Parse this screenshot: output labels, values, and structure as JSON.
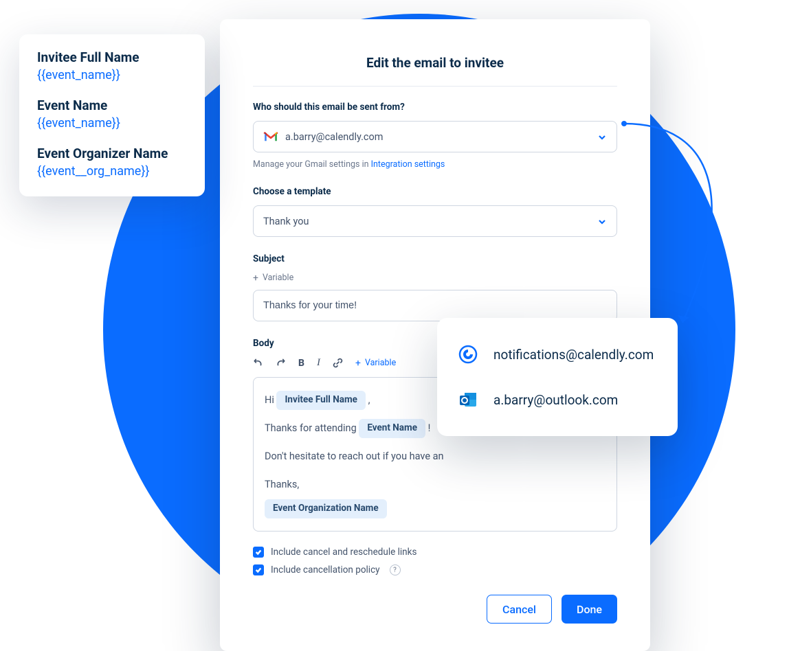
{
  "variables_card": {
    "items": [
      {
        "label": "Invitee Full Name",
        "token": "{{event_name}}"
      },
      {
        "label": "Event Name",
        "token": "{{event_name}}"
      },
      {
        "label": "Event Organizer Name",
        "token": "{{event__org_name}}"
      }
    ]
  },
  "modal": {
    "title": "Edit the email to invitee",
    "sender": {
      "label": "Who should this email be sent from?",
      "selected": "a.barry@calendly.com",
      "helper_prefix": "Manage your Gmail settings in ",
      "helper_link": "Integration settings"
    },
    "template": {
      "label": "Choose a template",
      "selected": "Thank you"
    },
    "subject": {
      "label": "Subject",
      "add_variable": "Variable",
      "value": "Thanks for your time!"
    },
    "body": {
      "label": "Body",
      "add_variable": "Variable",
      "greeting_prefix": "Hi  ",
      "greeting_chip": "Invitee Full Name",
      "greeting_suffix": "  ,",
      "line2_prefix": "Thanks for attending  ",
      "line2_chip": "Event Name",
      "line2_suffix": "  !",
      "line3": "Don't hesitate to reach out if you have an",
      "signoff": "Thanks,",
      "signoff_chip": "Event Organization Name"
    },
    "options": {
      "include_links": "Include cancel and reschedule links",
      "include_policy": "Include cancellation policy"
    },
    "footer": {
      "cancel": "Cancel",
      "done": "Done"
    }
  },
  "sender_options": [
    {
      "icon": "calendly",
      "email": "notifications@calendly.com"
    },
    {
      "icon": "outlook",
      "email": "a.barry@outlook.com"
    }
  ]
}
